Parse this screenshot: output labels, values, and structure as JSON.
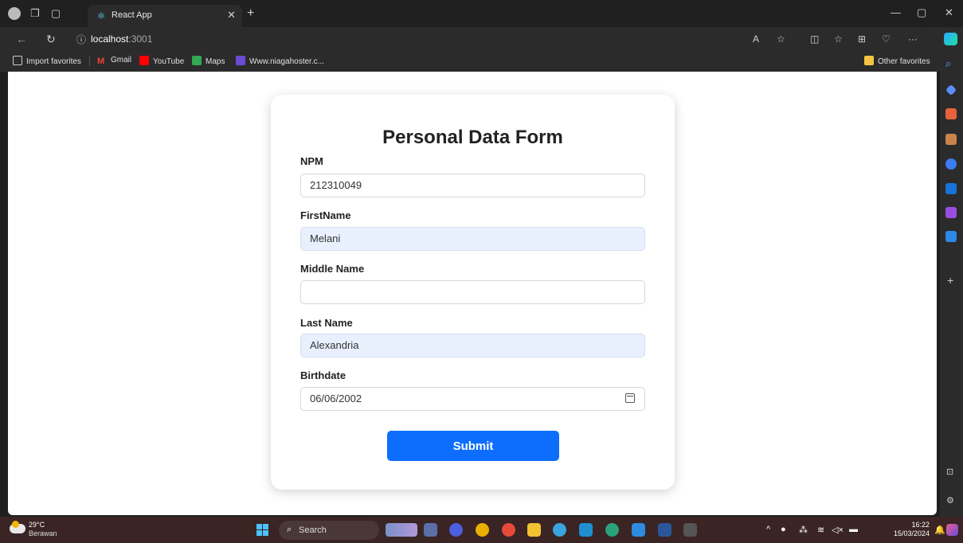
{
  "browser": {
    "tab_title": "React App",
    "url_host": "localhost",
    "url_port": ":3001"
  },
  "bookmarks": {
    "import_favorites": "Import favorites",
    "gmail": "Gmail",
    "youtube": "YouTube",
    "maps": "Maps",
    "niagahoster": "Www.niagahoster.c...",
    "other_favorites": "Other favorites"
  },
  "form": {
    "title": "Personal Data Form",
    "npm_label": "NPM",
    "npm_value": "212310049",
    "firstname_label": "FirstName",
    "firstname_value": "Melani",
    "middlename_label": "Middle Name",
    "middlename_value": "",
    "lastname_label": "Last Name",
    "lastname_value": "Alexandria",
    "birthdate_label": "Birthdate",
    "birthdate_value": "06/06/2002",
    "submit_label": "Submit"
  },
  "taskbar": {
    "temperature": "29°C",
    "weather": "Berawan",
    "search_placeholder": "Search",
    "time": "16:22",
    "date": "15/03/2024"
  },
  "colors": {
    "accent": "#0d6efd",
    "autofill": "#e8f0fe"
  }
}
